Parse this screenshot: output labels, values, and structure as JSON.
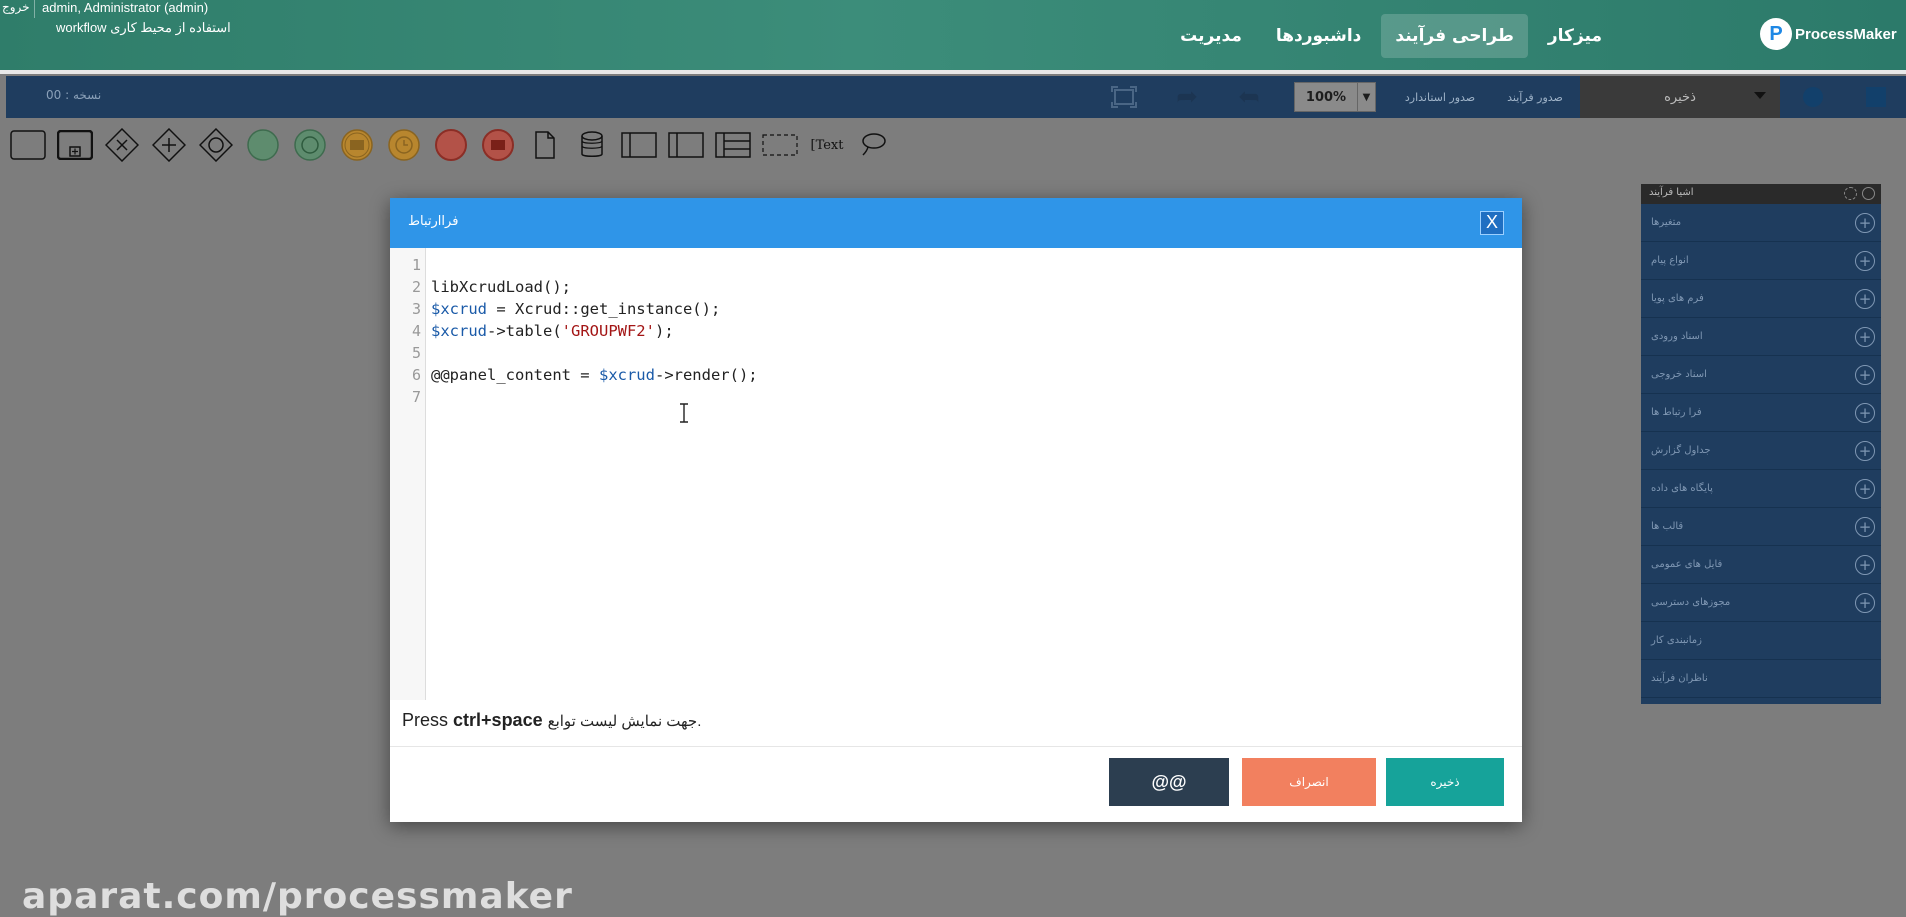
{
  "header": {
    "logout": "خروج",
    "user_name": "admin, Administrator (admin)",
    "user_sub": "استفاده از محیط کاری workflow",
    "nav": [
      "میزکار",
      "طراحی فرآیند",
      "داشبوردها",
      "مدیریت"
    ],
    "active_nav": "طراحی فرآیند",
    "logo": "ProcessMaker"
  },
  "toolbar": {
    "version": "نسخه : 00",
    "zoom": "100%",
    "save": "ذخیره",
    "btn_process": "صدور فرآیند",
    "btn_standard": "صدور استاندارد"
  },
  "palette": {
    "text_tool": "[Text"
  },
  "right_panel": {
    "title": "اشیا فرآیند",
    "items": [
      "متغیرها",
      "انواع پیام",
      "فرم های پویا",
      "اسناد ورودی",
      "اسناد خروجی",
      "فرا رتباط ها",
      "جداول گزارش",
      "پایگاه های داده",
      "قالب ها",
      "فایل های عمومی",
      "مجوزهای دسترسی",
      "زمانبندی کار",
      "ناظران فرآیند"
    ]
  },
  "modal": {
    "title": "فراارتباط",
    "close": "X",
    "line_numbers": [
      "1",
      "2",
      "3",
      "4",
      "5",
      "6",
      "7"
    ],
    "hint_press": "Press",
    "hint_keys": "ctrl+space",
    "hint_rest": "جهت نمایش لیست توابع.",
    "btn_at": "@@",
    "btn_cancel": "انصراف",
    "btn_save": "ذخیره"
  },
  "code": {
    "l2": "libXcrudLoad();",
    "l3_var": "$xcrud",
    "l3_rest": " = Xcrud::get_instance();",
    "l4_var": "$xcrud",
    "l4_mid": "->table(",
    "l4_str": "'GROUPWF2'",
    "l4_end": ");",
    "l6_pre": "@@panel_content = ",
    "l6_var": "$xcrud",
    "l6_end": "->render();"
  },
  "watermark": "aparat.com/processmaker"
}
